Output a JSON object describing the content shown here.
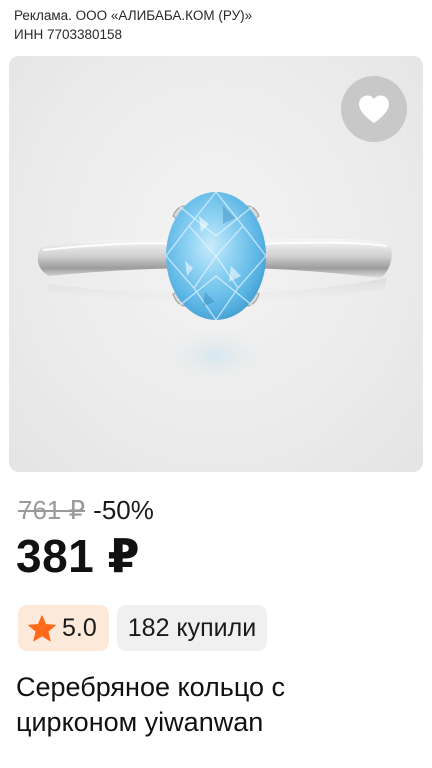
{
  "ad": {
    "line1": "Реклама. ООО «АЛИБАБА.КОМ (РУ)»",
    "line2": "ИНН 7703380158"
  },
  "product": {
    "image_icon": "ring-photo",
    "favorite_icon": "heart-icon",
    "old_price": "761 ₽",
    "discount": "-50%",
    "price": "381 ₽",
    "rating": "5.0",
    "rating_icon": "star-icon",
    "sold": "182 купили",
    "title_line1": "Серебряное кольцо с",
    "title_line2": "цирконом yiwanwan"
  },
  "colors": {
    "star": "#ff6a1a",
    "rating_bg": "#fde9d9",
    "badge_bg": "#f0f0f0",
    "fav_bg": "#c8c8c8"
  }
}
